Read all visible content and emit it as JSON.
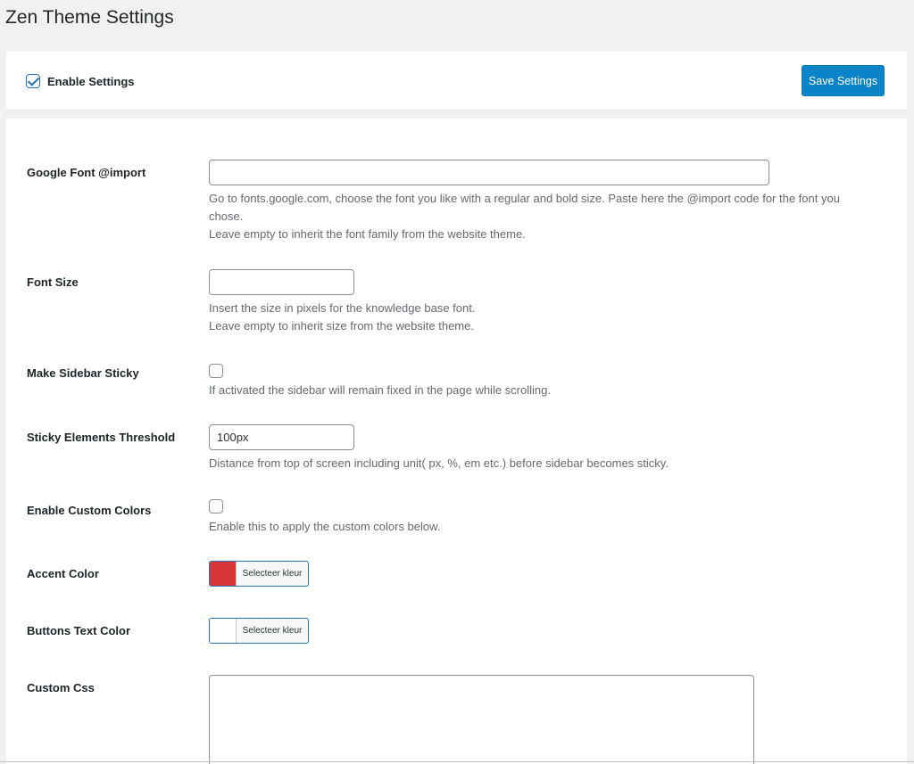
{
  "page": {
    "title": "Zen Theme Settings"
  },
  "top_bar": {
    "enable_label": "Enable Settings",
    "enable_checked": true,
    "save_label": "Save Settings"
  },
  "settings": {
    "google_font": {
      "label": "Google Font @import",
      "value": "",
      "desc_line1": "Go to fonts.google.com, choose the font you like with a regular and bold size. Paste here the @import code for the font you",
      "desc_line2": "chose.",
      "desc_line3": "Leave empty to inherit the font family from the website theme."
    },
    "font_size": {
      "label": "Font Size",
      "value": "",
      "desc_line1": "Insert the size in pixels for the knowledge base font.",
      "desc_line2": "Leave empty to inherit size from the website theme."
    },
    "sticky_sidebar": {
      "label": "Make Sidebar Sticky",
      "checked": false,
      "desc": "If activated the sidebar will remain fixed in the page while scrolling."
    },
    "sticky_threshold": {
      "label": "Sticky Elements Threshold",
      "value": "100px",
      "desc": "Distance from top of screen including unit( px, %, em etc.) before sidebar becomes sticky."
    },
    "custom_colors": {
      "label": "Enable Custom Colors",
      "checked": false,
      "desc": "Enable this to apply the custom colors below."
    },
    "accent_color": {
      "label": "Accent Color",
      "picker_label": "Selecteer kleur",
      "color": "#d63638"
    },
    "buttons_text_color": {
      "label": "Buttons Text Color",
      "picker_label": "Selecteer kleur",
      "color": "#ffffff"
    },
    "custom_css": {
      "label": "Custom Css",
      "value": ""
    }
  },
  "colors": {
    "primary_button": "#0a84c7",
    "background": "#f1f1f1",
    "panel": "#ffffff"
  }
}
